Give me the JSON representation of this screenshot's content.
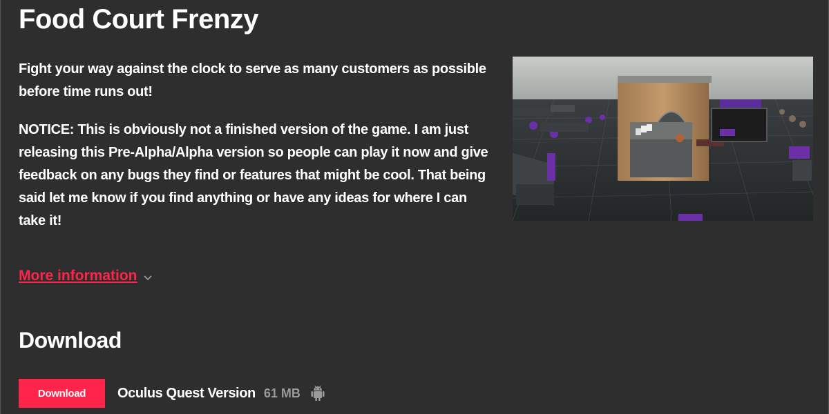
{
  "game": {
    "title": "Food Court Frenzy",
    "tagline": "Fight your way against the clock to serve as many customers as possible before time runs out!",
    "notice": "NOTICE: This is obviously not a finished version of the game. I am just releasing this Pre-Alpha/Alpha version so people can play it now and give feedback on any bugs they find or features that might be cool. That being said let me know if you find anything or have any ideas for where I can take it!"
  },
  "more_info": {
    "label": "More information",
    "icon": "chevron-down-icon",
    "color": "#ff2449"
  },
  "download": {
    "heading": "Download",
    "button_label": "Download",
    "file_name": "Oculus Quest Version",
    "file_size": "61 MB",
    "platform_icon": "android-icon"
  },
  "colors": {
    "background": "#2e2e2e",
    "accent": "#ff2449",
    "muted": "#9a9a9a"
  }
}
